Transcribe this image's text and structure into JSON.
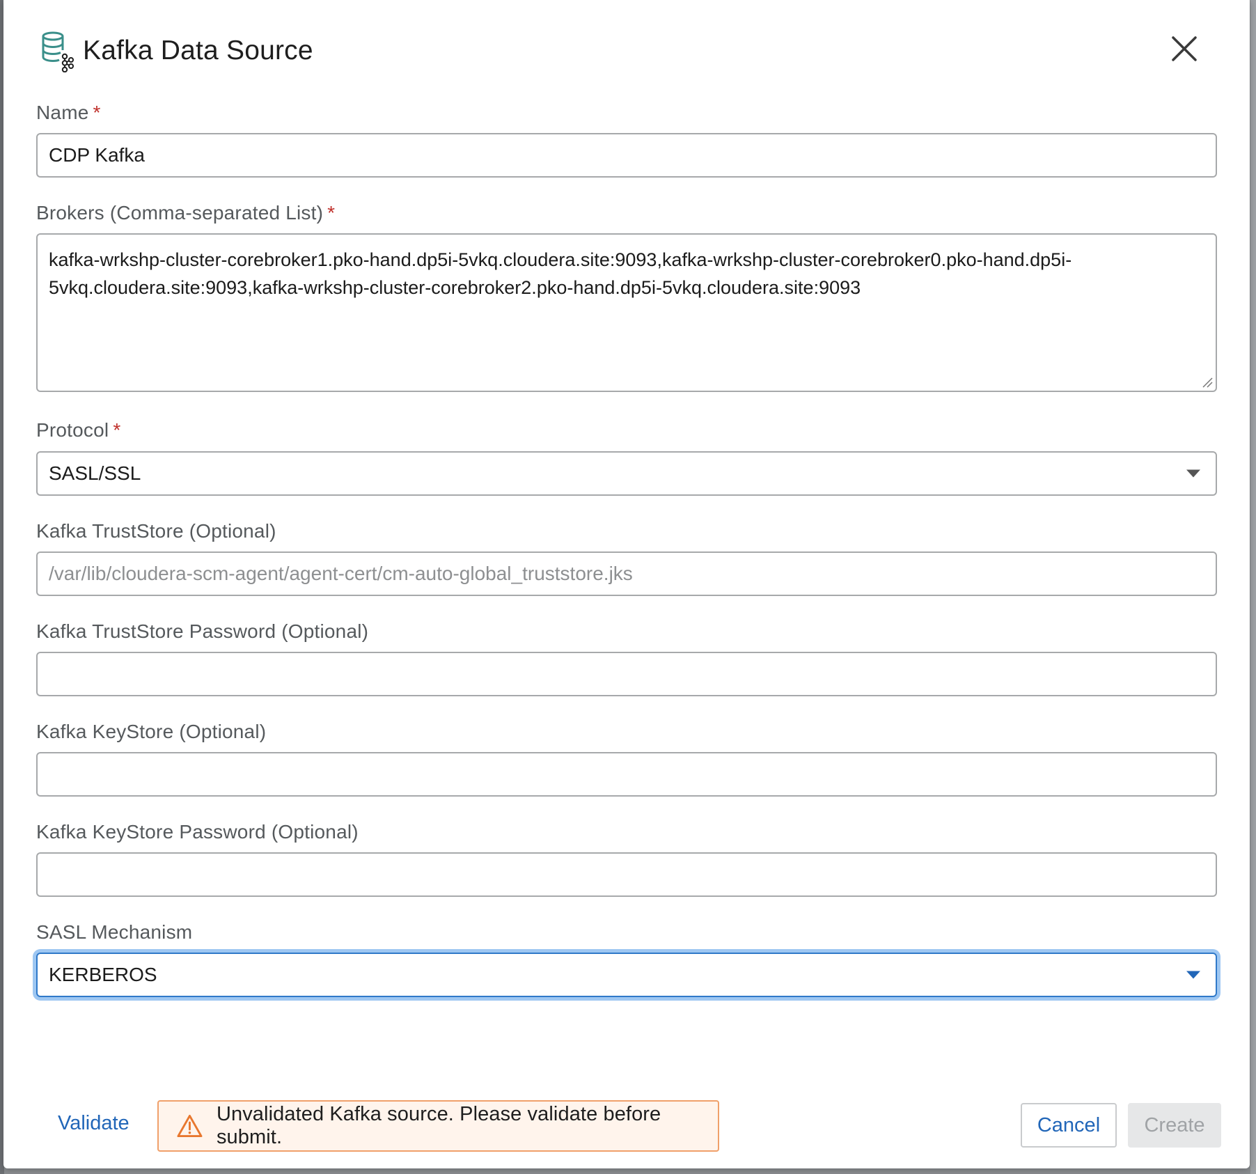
{
  "dialog": {
    "title": "Kafka Data Source",
    "icon": "database-kafka-icon",
    "close_icon": "close-icon"
  },
  "fields": {
    "name": {
      "label": "Name",
      "required_mark": "*",
      "value": "CDP Kafka"
    },
    "brokers": {
      "label": "Brokers (Comma-separated List)",
      "required_mark": "*",
      "value": "kafka-wrkshp-cluster-corebroker1.pko-hand.dp5i-5vkq.cloudera.site:9093,kafka-wrkshp-cluster-corebroker0.pko-hand.dp5i-5vkq.cloudera.site:9093,kafka-wrkshp-cluster-corebroker2.pko-hand.dp5i-5vkq.cloudera.site:9093",
      "line1": "kafka-wrkshp-cluster-corebroker1.pko-hand.dp5i-5vkq.cloudera.site:9093,kafka-wrkshp-cluster-corebroker0.pko-hand.dp5i-",
      "line2": "5vkq.cloudera.site:9093,kafka-wrkshp-cluster-corebroker2.pko-hand.dp5i-5vkq.cloudera.site:9093"
    },
    "protocol": {
      "label": "Protocol",
      "required_mark": "*",
      "value": "SASL/SSL"
    },
    "truststore": {
      "label": "Kafka TrustStore (Optional)",
      "value": "",
      "placeholder": "/var/lib/cloudera-scm-agent/agent-cert/cm-auto-global_truststore.jks"
    },
    "truststore_password": {
      "label": "Kafka TrustStore Password (Optional)",
      "value": ""
    },
    "keystore": {
      "label": "Kafka KeyStore (Optional)",
      "value": ""
    },
    "keystore_password": {
      "label": "Kafka KeyStore Password (Optional)",
      "value": ""
    },
    "sasl_mechanism": {
      "label": "SASL Mechanism",
      "value": "KERBEROS"
    }
  },
  "footer": {
    "validate_label": "Validate",
    "warning_icon": "warning-triangle-icon",
    "warning_text": "Unvalidated Kafka source. Please validate before submit.",
    "cancel_label": "Cancel",
    "create_label": "Create"
  },
  "colors": {
    "accent": "#2166b8",
    "required": "#c0312c",
    "warning_border": "#f0a06a",
    "warning_bg": "#fff4ec",
    "icon_teal": "#3a8f8a"
  }
}
